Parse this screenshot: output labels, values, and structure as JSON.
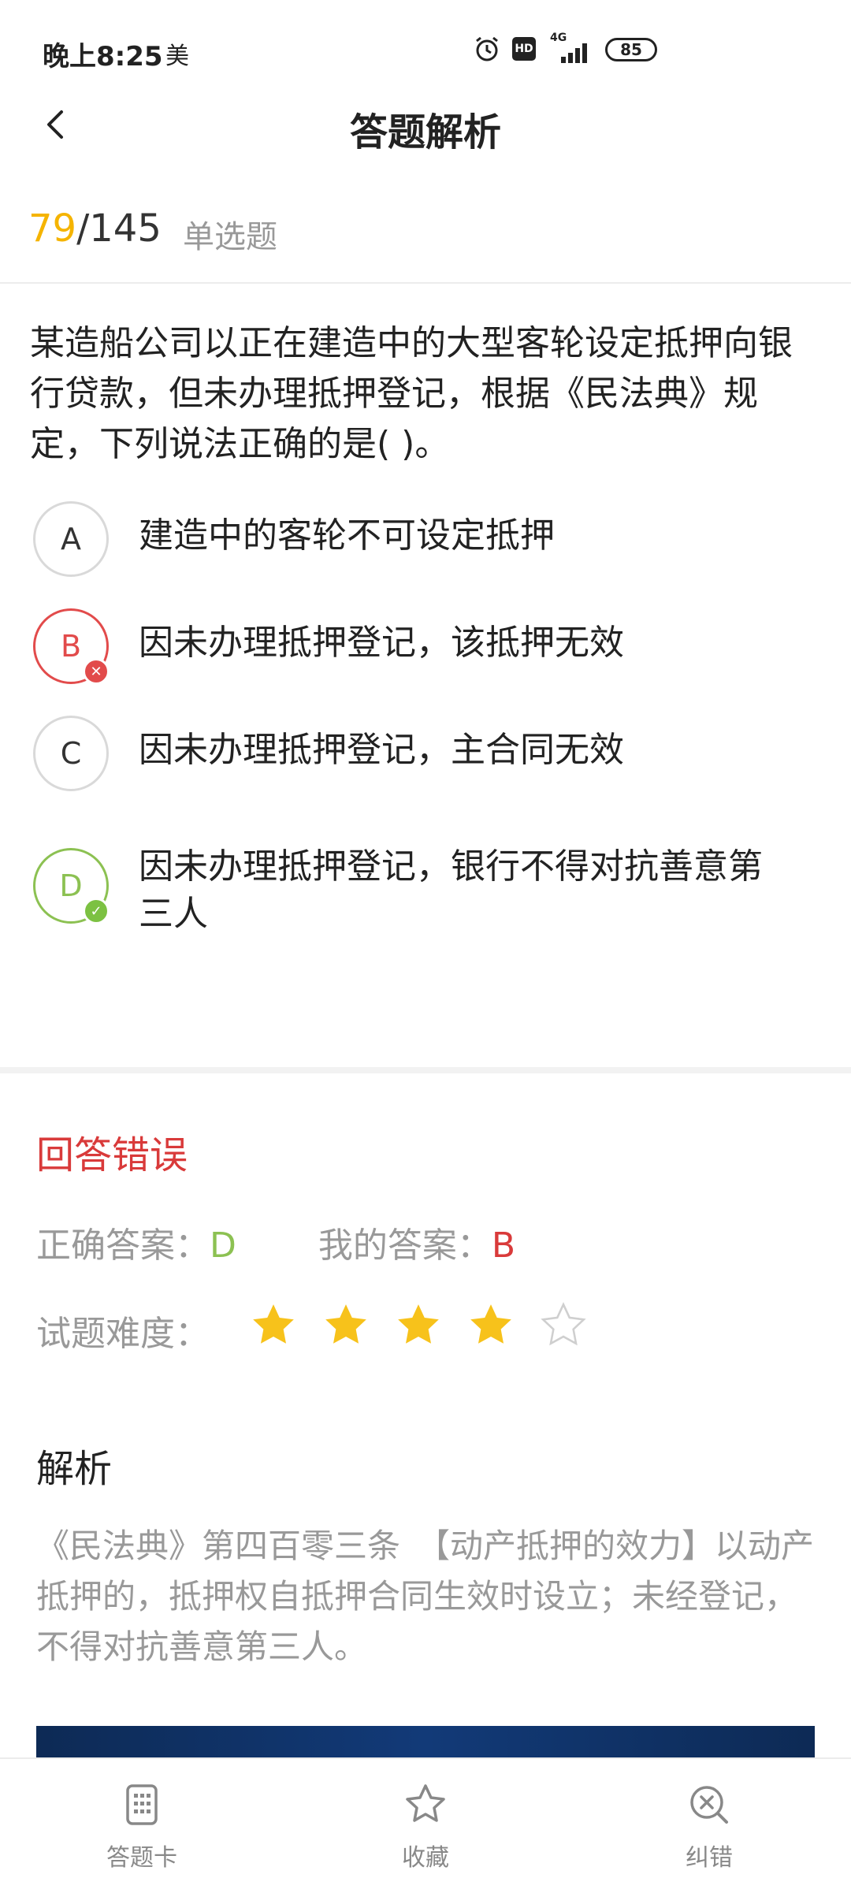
{
  "status": {
    "time": "晚上8:25",
    "extra": "美",
    "network": "4G",
    "battery": "85"
  },
  "header": {
    "title": "答题解析"
  },
  "progress": {
    "current": "79",
    "total": "/145",
    "question_type": "单选题"
  },
  "question": {
    "text": "某造船公司以正在建造中的大型客轮设定抵押向银行贷款，但未办理抵押登记，根据《民法典》规定，下列说法正确的是( )。",
    "options": [
      {
        "letter": "A",
        "text": "建造中的客轮不可设定抵押",
        "state": "normal"
      },
      {
        "letter": "B",
        "text": "因未办理抵押登记，该抵押无效",
        "state": "wrong"
      },
      {
        "letter": "C",
        "text": "因未办理抵押登记，主合同无效",
        "state": "normal"
      },
      {
        "letter": "D",
        "text": "因未办理抵押登记，银行不得对抗善意第三人",
        "state": "correct"
      }
    ]
  },
  "result": {
    "title": "回答错误",
    "correct_label": "正确答案：",
    "correct_value": "D",
    "my_label": "我的答案：",
    "my_value": "B",
    "difficulty_label": "试题难度：",
    "difficulty_rating": 4,
    "difficulty_max": 5
  },
  "analysis": {
    "title": "解析",
    "text": "《民法典》第四百零三条　【动产抵押的效力】以动产抵押的，抵押权自抵押合同生效时设立；未经登记，不得对抗善意第三人。"
  },
  "bottom_nav": [
    {
      "label": "答题卡",
      "icon": "answer-card-icon"
    },
    {
      "label": "收藏",
      "icon": "star-outline-icon"
    },
    {
      "label": "纠错",
      "icon": "search-x-icon"
    }
  ],
  "colors": {
    "accent_yellow": "#f5b400",
    "wrong_red": "#d93a3a",
    "correct_green": "#8cc152"
  }
}
